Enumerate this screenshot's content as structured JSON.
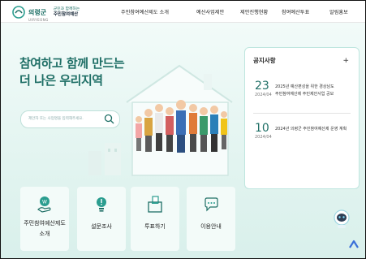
{
  "header": {
    "logo_name": "의령군",
    "logo_en": "UIRYEONG",
    "logo_slogan": "군민과 함께하는",
    "logo_title": "주민참여예산",
    "nav": [
      "주민참여예산제도 소개",
      "예산사업제안",
      "제안진행현황",
      "참여예산투표",
      "알림홍보"
    ]
  },
  "hero": {
    "headline_1": "참여하고 함께 만드는",
    "headline_2": "더 나은 우리지역",
    "search_placeholder": "제안자 또는 사업명을 입력해주세요."
  },
  "notice": {
    "title": "공지사항",
    "more": "+",
    "items": [
      {
        "day": "23",
        "ym": "2024/04",
        "text_1": "2025년 예산편성을 위한 경상남도",
        "text_2": "주민참여예산제 주민제안사업 공모"
      },
      {
        "day": "10",
        "ym": "2024/04",
        "text_1": "2024년 의령군 주민참여예산제 운영 계획",
        "text_2": ""
      }
    ]
  },
  "cards": [
    {
      "label_1": "주민참여예산제도",
      "label_2": "소개"
    },
    {
      "label_1": "설문조사",
      "label_2": ""
    },
    {
      "label_1": "투표하기",
      "label_2": ""
    },
    {
      "label_1": "이용안내",
      "label_2": ""
    }
  ],
  "colors": {
    "brand": "#1f6f66",
    "accent": "#2a9d8f",
    "hero_bg": "#e2f4f0"
  }
}
